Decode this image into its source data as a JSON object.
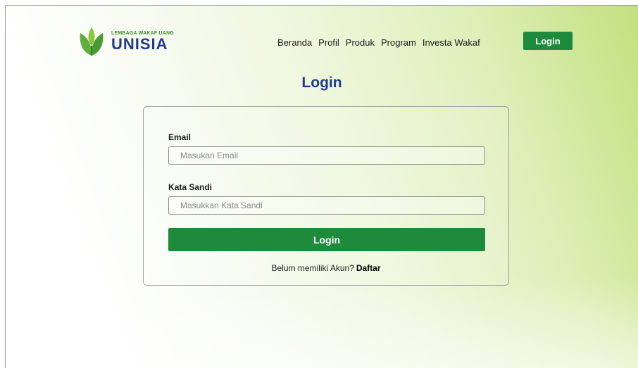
{
  "brand": {
    "subtitle": "LEMBAGA WAKAF UANG",
    "name": "UNISIA",
    "colors": {
      "primary_green": "#1e8a3b",
      "title_blue": "#1f3a8f",
      "leaf_green": "#5fae3e"
    }
  },
  "nav": {
    "items": [
      {
        "label": "Beranda"
      },
      {
        "label": "Profil"
      },
      {
        "label": "Produk"
      },
      {
        "label": "Program"
      },
      {
        "label": "Investa Wakaf"
      }
    ],
    "login_label": "Login"
  },
  "page": {
    "title": "Login"
  },
  "form": {
    "email": {
      "label": "Email",
      "placeholder": "Masukan Email",
      "value": ""
    },
    "password": {
      "label": "Kata Sandi",
      "placeholder": "Masukkan Kata Sandi",
      "value": ""
    },
    "submit_label": "Login",
    "register_prompt": "Belum memiliki Akun?",
    "register_link": "Daftar"
  },
  "icons": {
    "logo": "leaf-logo-icon"
  }
}
